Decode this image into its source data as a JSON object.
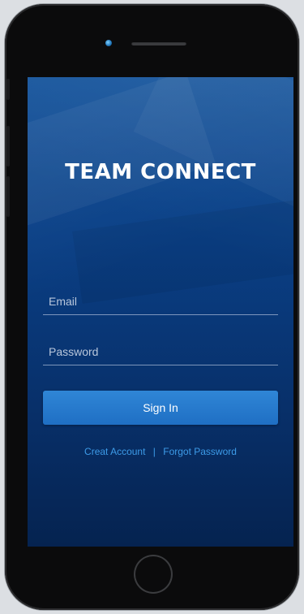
{
  "app": {
    "title": "TEAM CONNECT"
  },
  "form": {
    "email_placeholder": "Email",
    "email_value": "",
    "password_placeholder": "Password",
    "password_value": "",
    "signin_label": "Sign In"
  },
  "links": {
    "create_account": "Creat Account",
    "separator": "|",
    "forgot_password": "Forgot Password"
  },
  "colors": {
    "screen_top": "#0d4e99",
    "screen_bottom": "#052350",
    "button": "#1f6fc4",
    "link": "#3d9be8"
  },
  "icons": {
    "front_camera": "camera-dot",
    "earpiece": "speaker-slot",
    "home": "home-button-ring"
  }
}
